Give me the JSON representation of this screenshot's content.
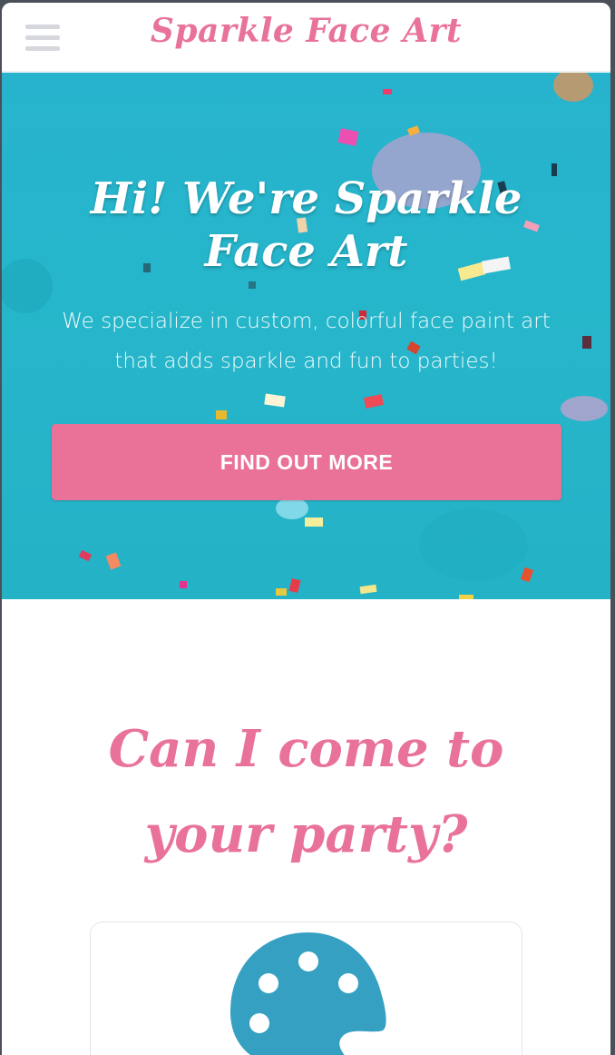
{
  "header": {
    "brand": "Sparkle Face Art",
    "menu_icon": "hamburger-menu-icon"
  },
  "hero": {
    "title": "Hi! We're Sparkle Face Art",
    "subtitle": "We specialize in custom, colorful face paint art that adds sparkle and fun to parties!",
    "cta_label": "FIND OUT MORE",
    "background_color": "#26b4cb"
  },
  "section": {
    "title": "Can I come to your party?",
    "card_icon": "palette-icon"
  },
  "colors": {
    "accent": "#e9729a",
    "hero": "#26b4cb",
    "icon": "#36a0c2"
  }
}
